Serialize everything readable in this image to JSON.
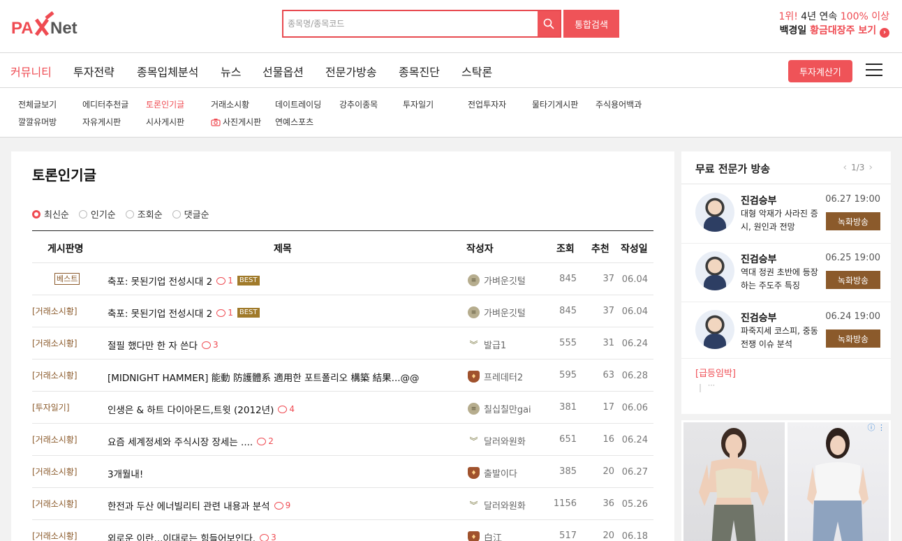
{
  "header": {
    "search_placeholder": "종목명/종목코드",
    "total_search_label": "통합검색",
    "promo_l1_a": "1위!",
    "promo_l1_b": " 4년 연속 ",
    "promo_l1_c": "100% 이상",
    "promo_l2_a": "백경일 ",
    "promo_l2_b": "황금대장주 보기"
  },
  "gnb": {
    "items": [
      "커뮤니티",
      "투자전략",
      "종목입체분석",
      "뉴스",
      "선물옵션",
      "전문가방송",
      "종목진단",
      "스탁론"
    ],
    "calc_label": "투자계산기"
  },
  "lnb": {
    "row1": [
      "전체글보기",
      "에디터추천글",
      "토론인기글",
      "거래소시황",
      "데이트레이딩",
      "강추이종목",
      "투자일기",
      "전업투자자",
      "물타기게시판",
      "주식용어백과"
    ],
    "row2": [
      "깔깔유머방",
      "자유게시판",
      "시사게시판",
      "사진게시판",
      "연예스포츠"
    ]
  },
  "main": {
    "title": "토론인기글",
    "sorts": [
      "최신순",
      "인기순",
      "조회순",
      "댓글순"
    ],
    "columns": {
      "board": "게시판명",
      "title": "제목",
      "writer": "작성자",
      "views": "조회",
      "rec": "추천",
      "date": "작성일"
    },
    "rows": [
      {
        "board": "베스트",
        "title": "축포: 못된기업 전성시대 2",
        "comments": "1",
        "best": "BEST",
        "writer": "가벼운깃털",
        "views": "845",
        "rec": "37",
        "date": "06.04"
      },
      {
        "board": "[거래소시황]",
        "title": "축포: 못된기업 전성시대 2",
        "comments": "1",
        "best": "BEST",
        "writer": "가벼운깃털",
        "views": "845",
        "rec": "37",
        "date": "06.04"
      },
      {
        "board": "[거래소시황]",
        "title": "절필 했다만 한 자 쓴다",
        "comments": "3",
        "best": "",
        "writer": "발급1",
        "views": "555",
        "rec": "31",
        "date": "06.24"
      },
      {
        "board": "[거래소시황]",
        "title": "[MIDNIGHT HAMMER] 能動 防護體系 適用한 포트폴리오 構築 結果...@@",
        "comments": "",
        "best": "",
        "writer": "프레데터2",
        "views": "595",
        "rec": "63",
        "date": "06.28"
      },
      {
        "board": "[투자일기]",
        "title": "인생은 & 하트 다이아몬드,트윗 (2012년)",
        "comments": "4",
        "best": "",
        "writer": "칠십칠만gai",
        "views": "381",
        "rec": "17",
        "date": "06.06"
      },
      {
        "board": "[거래소시황]",
        "title": "요즘 세계정세와 주식시장 장세는 ....",
        "comments": "2",
        "best": "",
        "writer": "달러와원화",
        "views": "651",
        "rec": "16",
        "date": "06.24"
      },
      {
        "board": "[거래소시황]",
        "title": "3개월내!",
        "comments": "",
        "best": "",
        "writer": "출발이다",
        "views": "385",
        "rec": "20",
        "date": "06.27"
      },
      {
        "board": "[거래소시황]",
        "title": "한전과 두산 에너빌리티 관련 내용과 분석",
        "comments": "9",
        "best": "",
        "writer": "달러와원화",
        "views": "1156",
        "rec": "36",
        "date": "05.26"
      },
      {
        "board": "[거래소시황]",
        "title": "외로운 이란,,,이대로는 힘들어보인다.",
        "comments": "3",
        "best": "",
        "writer": "白江",
        "views": "517",
        "rec": "20",
        "date": "06.18"
      }
    ]
  },
  "side": {
    "title": "무료 전문가 방송",
    "pager": "1/3",
    "broadcasts": [
      {
        "name": "진검승부",
        "time": "06.27 19:00",
        "desc": "대형 악재가 사라진 증시, 원인과 전망",
        "btn": "녹화방송"
      },
      {
        "name": "진검승부",
        "time": "06.25 19:00",
        "desc": "역대 정권 초반에 등장하는 주도주 특징",
        "btn": "녹화방송"
      },
      {
        "name": "진검승부",
        "time": "06.24 19:00",
        "desc": "파죽지세 코스피, 중동 전쟁 이슈 분석",
        "btn": "녹화방송"
      }
    ],
    "urgent": "[급등임박]"
  }
}
